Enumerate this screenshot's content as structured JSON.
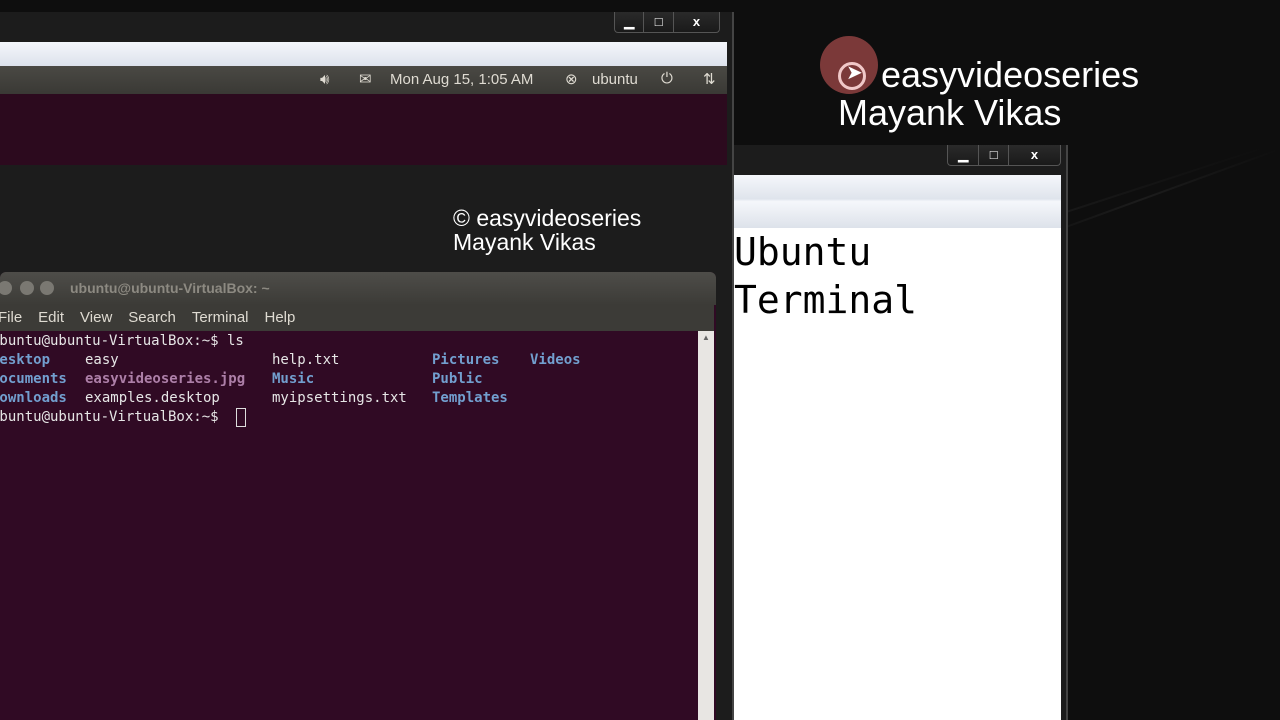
{
  "vm_window": {
    "buttons": {
      "minimize": "▁",
      "maximize": "□",
      "close": "x"
    },
    "panel": {
      "datetime": "Mon Aug 15, 1:05 AM",
      "user": "ubuntu"
    },
    "watermark": {
      "line1": "© easyvideoseries",
      "line2": "Mayank Vikas"
    }
  },
  "terminal": {
    "title": "ubuntu@ubuntu-VirtualBox: ~",
    "menu": [
      "File",
      "Edit",
      "View",
      "Search",
      "Terminal",
      "Help"
    ],
    "prompt_cmd": "ubuntu@ubuntu-VirtualBox:~$ ls",
    "listing": [
      [
        "Desktop",
        "easy",
        "help.txt",
        "Pictures",
        "Videos"
      ],
      [
        "Documents",
        "easyvideoseries.jpg",
        "Music",
        "Public",
        ""
      ],
      [
        "Downloads",
        "examples.desktop",
        "myipsettings.txt",
        "Templates",
        ""
      ]
    ],
    "prompt": "ubuntu@ubuntu-VirtualBox:~$"
  },
  "notes_window": {
    "buttons": {
      "minimize": "▁",
      "maximize": "□",
      "close": "x"
    },
    "text_line1": "Ubuntu",
    "text_line2": "Terminal"
  },
  "brand": {
    "line1": "easyvideoseries",
    "line2": "Mayank Vikas",
    "accent": "#a04848"
  }
}
